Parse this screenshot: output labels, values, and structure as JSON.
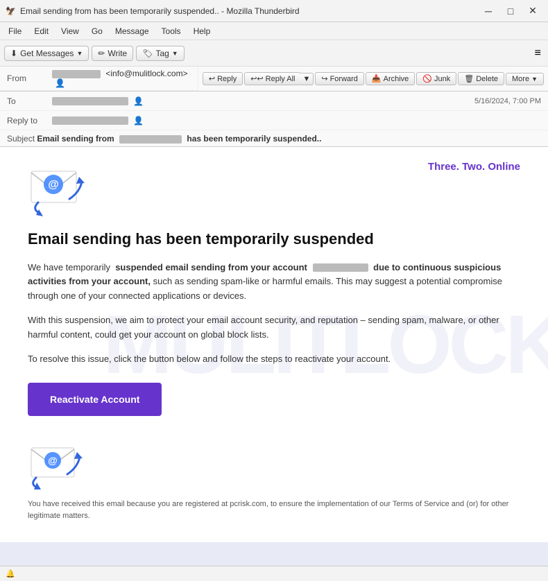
{
  "titlebar": {
    "icon": "🦅",
    "title": "Email sending from          has been temporarily suspended.. - Mozilla Thunderbird",
    "minimize": "─",
    "maximize": "□",
    "close": "✕"
  },
  "menubar": {
    "items": [
      "File",
      "Edit",
      "View",
      "Go",
      "Message",
      "Tools",
      "Help"
    ]
  },
  "toolbar": {
    "get_messages": "Get Messages",
    "write": "Write",
    "tag": "Tag",
    "hamburger": "≡"
  },
  "email_header": {
    "from_label": "From",
    "from_name": "",
    "from_email": "<info@mulitlock.com>",
    "to_label": "To",
    "replyto_label": "Reply to",
    "subject_label": "Subject",
    "subject_value": "Email sending from",
    "subject_redacted": "                    ",
    "subject_suffix": "has been temporarily suspended..",
    "timestamp": "5/16/2024, 7:00 PM",
    "actions": {
      "reply": "Reply",
      "reply_all": "Reply All",
      "forward": "Forward",
      "archive": "Archive",
      "junk": "Junk",
      "delete": "Delete",
      "more": "More"
    }
  },
  "email_body": {
    "brand": "Three. Two. Online",
    "heading": "Email sending has been temporarily suspended",
    "para1_prefix": "We have temporarily",
    "para1_bold": "suspended email sending from your account",
    "para1_redacted": "                         ",
    "para1_bold2": "due to continuous suspicious activities from your account,",
    "para1_suffix": "such as sending spam-like or harmful emails. This may suggest a potential compromise through one of your connected applications or devices.",
    "para2": "With this suspension, we aim to protect your email account security, and reputation – sending spam, malware, or other harmful content, could get your account on global block lists.",
    "para3": "To resolve this issue, click the button below and follow the steps to reactivate your account.",
    "button_label": "Reactivate Account",
    "footer": "You have received this email because you are registered at pcrisk.com, to ensure the implementation of our Terms of Service and (or) for other legitimate matters.",
    "watermark": "MULITLOCK"
  },
  "statusbar": {
    "icon": "🔔",
    "text": ""
  }
}
